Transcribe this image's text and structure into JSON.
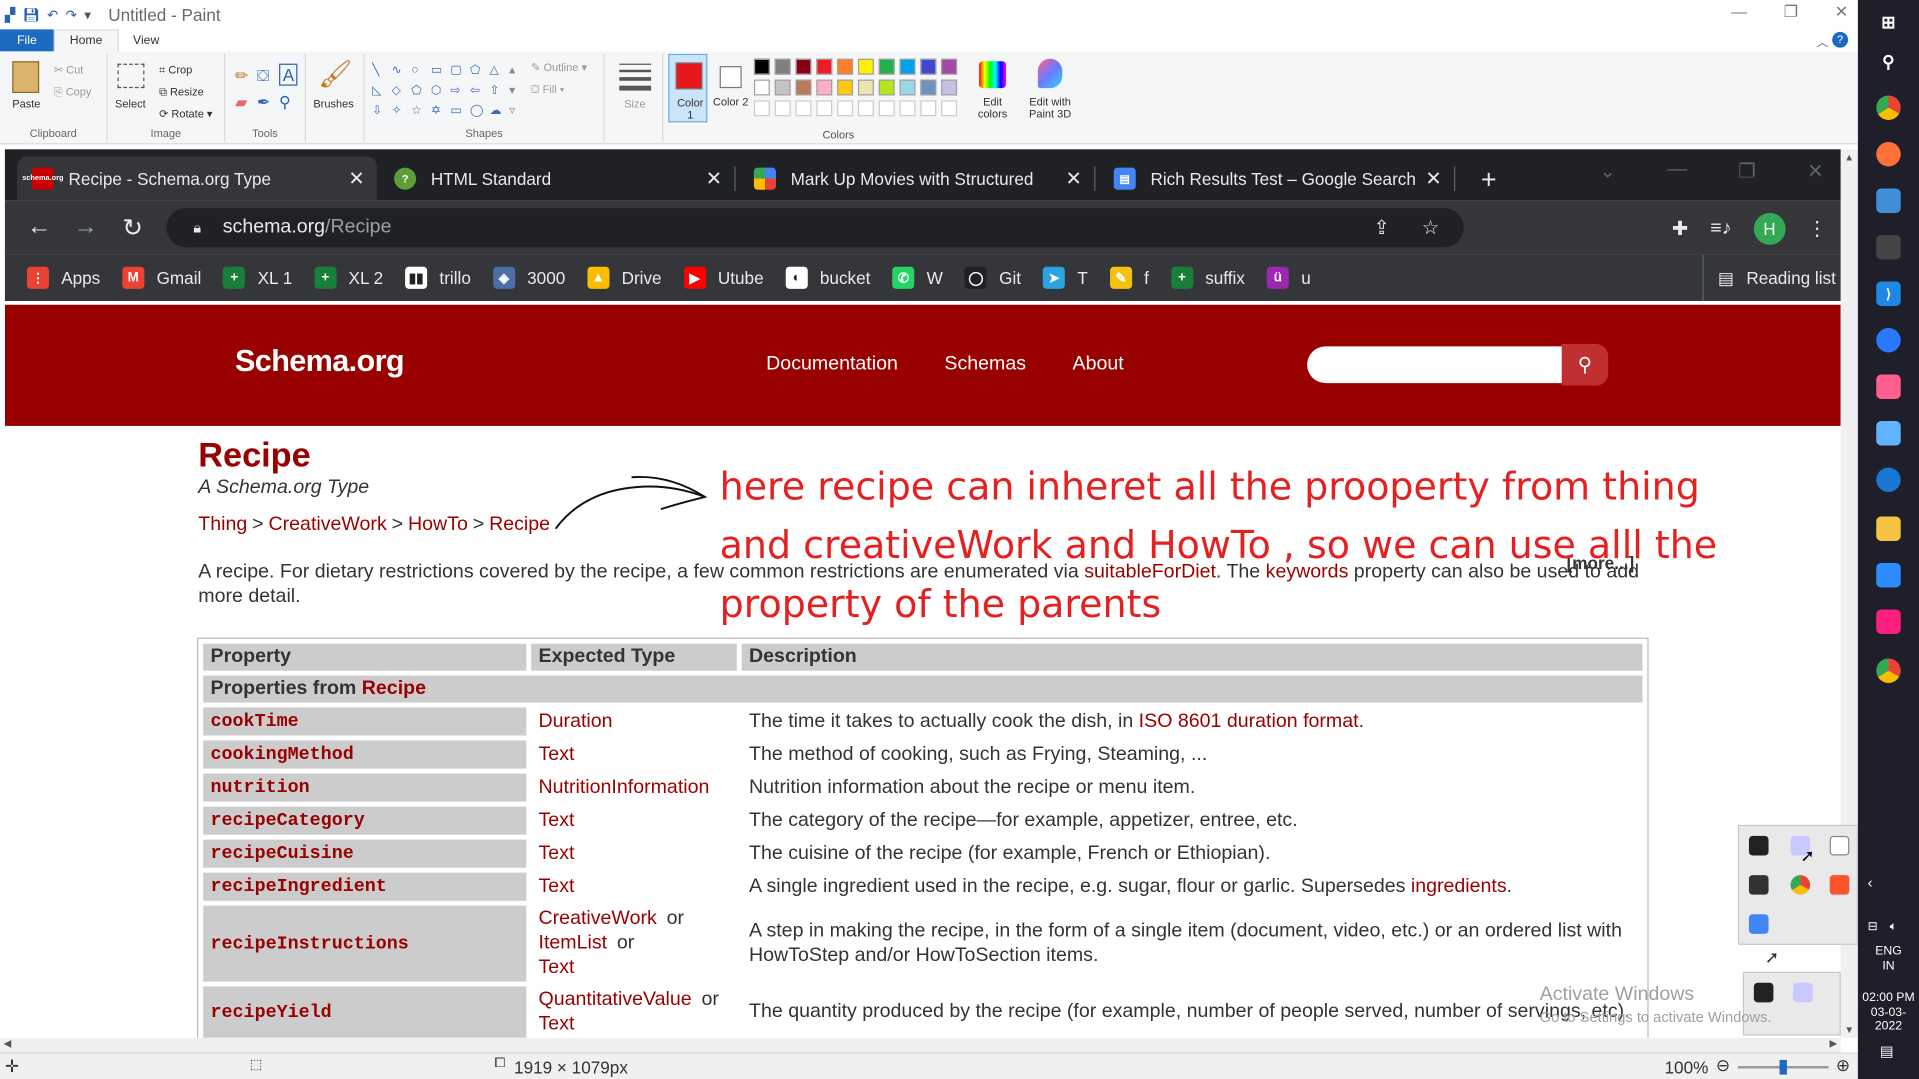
{
  "paint": {
    "title": "Untitled - Paint",
    "menu": {
      "file": "File",
      "home": "Home",
      "view": "View"
    },
    "clipboard": {
      "paste": "Paste",
      "cut": "Cut",
      "copy": "Copy",
      "label": "Clipboard"
    },
    "image": {
      "select": "Select",
      "crop": "Crop",
      "resize": "Resize",
      "rotate": "Rotate",
      "label": "Image"
    },
    "tools": {
      "label": "Tools"
    },
    "brushes": {
      "label": "Brushes"
    },
    "shapes": {
      "outline": "Outline",
      "fill": "Fill",
      "label": "Shapes"
    },
    "size": {
      "label": "Size"
    },
    "colors": {
      "color1": "Color 1",
      "color1_value": "#e8191e",
      "color2": "Color 2",
      "edit": "Edit colors",
      "label": "Colors",
      "edit3d": "Edit with Paint 3D"
    },
    "palette_row1": [
      "#000000",
      "#7f7f7f",
      "#880015",
      "#ed1c24",
      "#ff7f27",
      "#fff200",
      "#22b14c",
      "#00a2e8",
      "#3f48cc",
      "#a349a4"
    ],
    "palette_row2": [
      "#ffffff",
      "#c3c3c3",
      "#b97a57",
      "#ffaec9",
      "#ffc90e",
      "#efe4b0",
      "#b5e61d",
      "#99d9ea",
      "#7092be",
      "#c8bfe7"
    ],
    "status": {
      "dimensions": "1919 × 1079px",
      "zoom": "100%"
    }
  },
  "chrome": {
    "tabs": [
      {
        "title": "Recipe - Schema.org Type",
        "fav": "schema.org"
      },
      {
        "title": "HTML Standard",
        "fav": "?"
      },
      {
        "title": "Mark Up Movies with Structured",
        "fav": ""
      },
      {
        "title": "Rich Results Test – Google Search",
        "fav": ""
      }
    ],
    "url_host": "schema.org",
    "url_path": "/Recipe",
    "profile_initial": "H",
    "bookmarks": [
      {
        "label": "Apps",
        "color": "#ea4335",
        "glyph": "⋮"
      },
      {
        "label": "Gmail",
        "color": "#ea4335",
        "glyph": "M"
      },
      {
        "label": "XL 1",
        "color": "#188038",
        "glyph": "+"
      },
      {
        "label": "XL 2",
        "color": "#188038",
        "glyph": "+"
      },
      {
        "label": "trillo",
        "color": "#ffffff",
        "glyph": "▮▮"
      },
      {
        "label": "3000",
        "color": "#4a6fa5",
        "glyph": "◈"
      },
      {
        "label": "Drive",
        "color": "#fbbc04",
        "glyph": "▲"
      },
      {
        "label": "Utube",
        "color": "#ff0000",
        "glyph": "▶"
      },
      {
        "label": "bucket",
        "color": "#ffffff",
        "glyph": "◐"
      },
      {
        "label": "W",
        "color": "#25d366",
        "glyph": "✆"
      },
      {
        "label": "Git",
        "color": "#202124",
        "glyph": "◯"
      },
      {
        "label": "T",
        "color": "#2aa3e0",
        "glyph": "➤"
      },
      {
        "label": "f",
        "color": "#f4c20d",
        "glyph": "✎"
      },
      {
        "label": "suffix",
        "color": "#188038",
        "glyph": "+"
      },
      {
        "label": "u",
        "color": "#9c27b0",
        "glyph": "ü"
      }
    ],
    "reading_list": "Reading list"
  },
  "site": {
    "logo": "Schema.org",
    "nav": [
      "Documentation",
      "Schemas",
      "About"
    ],
    "title": "Recipe",
    "subtitle": "A Schema.org Type",
    "breadcrumb": [
      "Thing",
      "CreativeWork",
      "HowTo",
      "Recipe"
    ],
    "breadcrumb_sep": ">",
    "desc_part1": "A recipe. For dietary restrictions covered by the recipe, a few common restrictions are enumerated via ",
    "desc_link1": "suitableForDiet",
    "desc_part2": ". The ",
    "desc_link2": "keywords",
    "desc_part3": " property can also be used to add more detail.",
    "more": "[more...]",
    "table": {
      "headers": [
        "Property",
        "Expected Type",
        "Description"
      ],
      "section_prefix": "Properties from ",
      "section_link": "Recipe",
      "rows": [
        {
          "name": "cookTime",
          "types": [
            "Duration"
          ],
          "desc_pre": "The time it takes to actually cook the dish, in ",
          "desc_link": "ISO 8601 duration format",
          "desc_post": "."
        },
        {
          "name": "cookingMethod",
          "types": [
            "Text"
          ],
          "desc_pre": "The method of cooking, such as Frying, Steaming, ...",
          "desc_link": "",
          "desc_post": ""
        },
        {
          "name": "nutrition",
          "types": [
            "NutritionInformation"
          ],
          "desc_pre": "Nutrition information about the recipe or menu item.",
          "desc_link": "",
          "desc_post": ""
        },
        {
          "name": "recipeCategory",
          "types": [
            "Text"
          ],
          "desc_pre": "The category of the recipe—for example, appetizer, entree, etc.",
          "desc_link": "",
          "desc_post": ""
        },
        {
          "name": "recipeCuisine",
          "types": [
            "Text"
          ],
          "desc_pre": "The cuisine of the recipe (for example, French or Ethiopian).",
          "desc_link": "",
          "desc_post": ""
        },
        {
          "name": "recipeIngredient",
          "types": [
            "Text"
          ],
          "desc_pre": "A single ingredient used in the recipe, e.g. sugar, flour or garlic. Supersedes ",
          "desc_link": "ingredients",
          "desc_post": "."
        },
        {
          "name": "recipeInstructions",
          "types": [
            "CreativeWork",
            "ItemList",
            "Text"
          ],
          "desc_pre": "A step in making the recipe, in the form of a single item (document, video, etc.) or an ordered list with HowToStep and/or HowToSection items.",
          "desc_link": "",
          "desc_post": ""
        },
        {
          "name": "recipeYield",
          "types": [
            "QuantitativeValue",
            "Text"
          ],
          "desc_pre": "The quantity produced by the recipe (for example, number of people served, number of servings, etc).",
          "desc_link": "",
          "desc_post": ""
        }
      ],
      "or_word": "or"
    }
  },
  "annotation": {
    "line1": "here recipe can inheret all the prooperty from thing",
    "line2": "and creativeWork and HowTo , so we can use alll the",
    "line3": "property of the parents",
    "color": "#e52020"
  },
  "windows": {
    "activate_title": "Activate Windows",
    "activate_sub": "Go to Settings to activate Windows.",
    "lang1": "ENG",
    "lang2": "IN",
    "time": "02:00 PM",
    "date": "03-03-2022"
  }
}
